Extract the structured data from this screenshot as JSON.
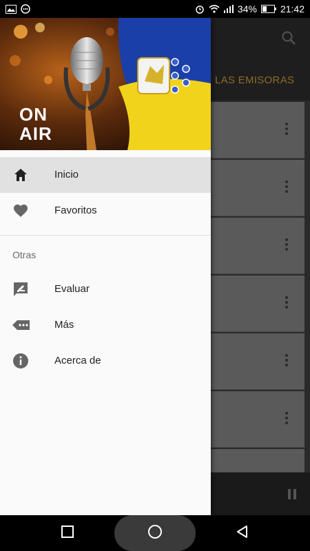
{
  "status": {
    "battery": "34%",
    "time": "21:42"
  },
  "app": {
    "tab_label": "LAS EMISORAS"
  },
  "drawer": {
    "header_text_line1": "ON",
    "header_text_line2": "AIR",
    "items": [
      {
        "label": "Inicio",
        "icon": "home-icon",
        "active": true
      },
      {
        "label": "Favoritos",
        "icon": "heart-icon",
        "active": false
      }
    ],
    "section_title": "Otras",
    "other_items": [
      {
        "label": "Evaluar",
        "icon": "rate-icon"
      },
      {
        "label": "Más",
        "icon": "more-icon"
      },
      {
        "label": "Acerca de",
        "icon": "info-icon"
      }
    ]
  },
  "colors": {
    "accent": "#8c6a2a",
    "drawer_bg": "#fafafa",
    "active_bg": "#e1e1e1",
    "flag_blue": "#1b3fa8",
    "flag_yellow": "#f2d31b"
  }
}
